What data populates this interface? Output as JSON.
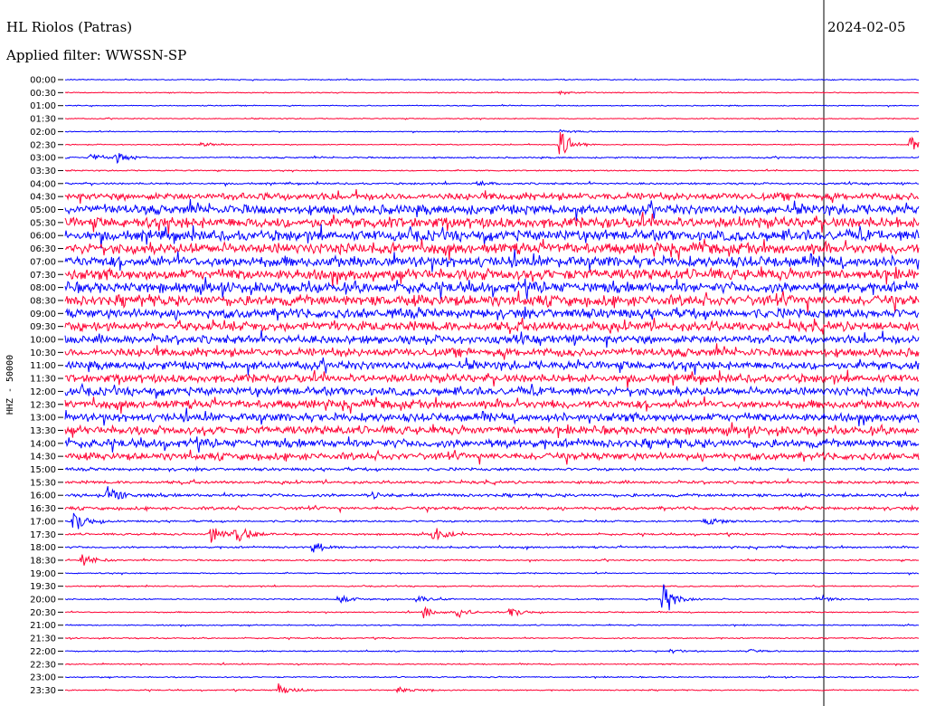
{
  "header": {
    "station": "HL Riolos (Patras)",
    "filter": "Applied filter: WWSSN-SP",
    "date": "2024-02-05"
  },
  "chart_data": {
    "type": "line",
    "title": "HL Riolos (Patras)",
    "ylabel": "HHZ - 50000",
    "x": "time within each 30-minute trace",
    "row_labels": [
      "00:00",
      "00:30",
      "01:00",
      "01:30",
      "02:00",
      "02:30",
      "03:00",
      "03:30",
      "04:00",
      "04:30",
      "05:00",
      "05:30",
      "06:00",
      "06:30",
      "07:00",
      "07:30",
      "08:00",
      "08:30",
      "09:00",
      "09:30",
      "10:00",
      "10:30",
      "11:00",
      "11:30",
      "12:00",
      "12:30",
      "13:00",
      "13:30",
      "14:00",
      "14:30",
      "15:00",
      "15:30",
      "16:00",
      "16:30",
      "17:00",
      "17:30",
      "18:00",
      "18:30",
      "19:00",
      "19:30",
      "20:00",
      "20:30",
      "21:00",
      "21:30",
      "22:00",
      "22:30",
      "23:00",
      "23:30"
    ],
    "colors": {
      "even_rows": "#0000ff",
      "odd_rows": "#ff0033",
      "axis": "#000000"
    },
    "noise_level": [
      0.4,
      0.4,
      0.4,
      0.4,
      0.4,
      0.4,
      0.6,
      0.5,
      0.8,
      3,
      4,
      4.5,
      4.5,
      4.5,
      4.5,
      4.5,
      4.5,
      4.5,
      4,
      4,
      3.5,
      3.5,
      3.5,
      3.5,
      3.5,
      3.5,
      3.5,
      3.5,
      3.5,
      3,
      1.2,
      1.2,
      1.3,
      1.3,
      0.8,
      0.8,
      0.8,
      0.6,
      0.5,
      0.5,
      0.5,
      0.5,
      0.5,
      0.5,
      0.5,
      0.5,
      0.5,
      0.5
    ],
    "events": [
      {
        "row": 1,
        "t": 0.58,
        "amp": 3
      },
      {
        "row": 4,
        "t": 0.58,
        "amp": 3
      },
      {
        "row": 5,
        "t": 0.58,
        "amp": 20
      },
      {
        "row": 5,
        "t": 0.16,
        "amp": 3
      },
      {
        "row": 5,
        "t": 0.99,
        "amp": 10
      },
      {
        "row": 6,
        "t": 0.03,
        "amp": 6
      },
      {
        "row": 6,
        "t": 0.06,
        "amp": 6
      },
      {
        "row": 8,
        "t": 0.48,
        "amp": 4
      },
      {
        "row": 32,
        "t": 0.05,
        "amp": 12
      },
      {
        "row": 32,
        "t": 0.36,
        "amp": 4
      },
      {
        "row": 34,
        "t": 0.01,
        "amp": 14
      },
      {
        "row": 34,
        "t": 0.75,
        "amp": 6
      },
      {
        "row": 35,
        "t": 0.17,
        "amp": 12
      },
      {
        "row": 35,
        "t": 0.2,
        "amp": 14
      },
      {
        "row": 35,
        "t": 0.43,
        "amp": 12
      },
      {
        "row": 36,
        "t": 0.29,
        "amp": 8
      },
      {
        "row": 37,
        "t": 0.02,
        "amp": 10
      },
      {
        "row": 40,
        "t": 0.32,
        "amp": 7
      },
      {
        "row": 40,
        "t": 0.41,
        "amp": 7
      },
      {
        "row": 40,
        "t": 0.7,
        "amp": 24
      },
      {
        "row": 40,
        "t": 0.88,
        "amp": 6
      },
      {
        "row": 41,
        "t": 0.42,
        "amp": 6
      },
      {
        "row": 41,
        "t": 0.46,
        "amp": 7
      },
      {
        "row": 41,
        "t": 0.52,
        "amp": 7
      },
      {
        "row": 44,
        "t": 0.71,
        "amp": 4
      },
      {
        "row": 44,
        "t": 0.8,
        "amp": 4
      },
      {
        "row": 47,
        "t": 0.25,
        "amp": 8
      },
      {
        "row": 47,
        "t": 0.39,
        "amp": 5
      }
    ]
  }
}
